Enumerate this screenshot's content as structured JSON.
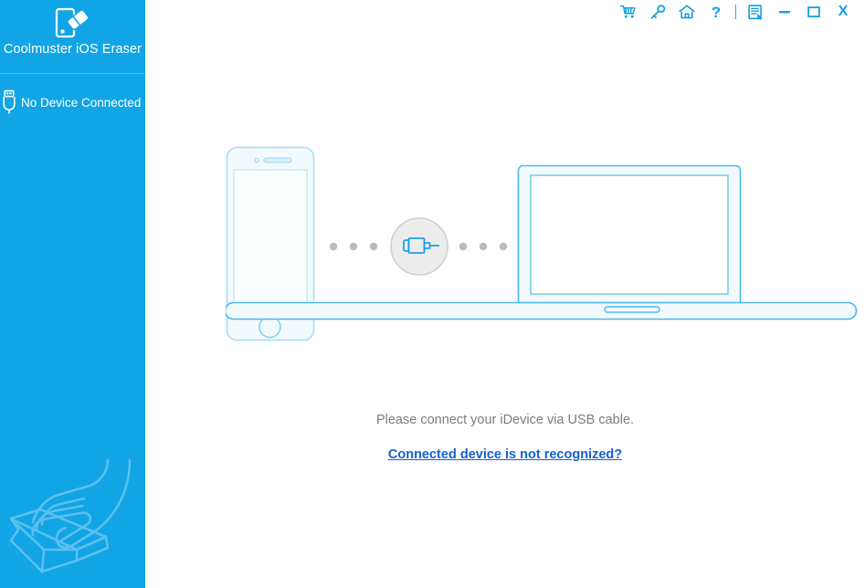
{
  "window": {
    "title": "Coolmuster iOS Eraser"
  },
  "sidebar": {
    "brand_title": "Coolmuster iOS Eraser",
    "logo_icon": "phone-eraser-icon",
    "device_status": {
      "icon": "usb-icon",
      "label": "No Device Connected"
    },
    "watermark_icon": "hand-holding-box-icon"
  },
  "titlebar": {
    "buttons": [
      {
        "name": "cart-icon",
        "label": ""
      },
      {
        "name": "key-icon",
        "label": ""
      },
      {
        "name": "home-icon",
        "label": ""
      },
      {
        "name": "help-icon",
        "label": "?"
      },
      {
        "name": "feedback-icon",
        "label": ""
      }
    ],
    "minimize_label": "",
    "maximize_label": "",
    "close_label": "X"
  },
  "main": {
    "illustration": {
      "phone_icon": "iphone-outline-icon",
      "connector_icon": "usb-plug-icon",
      "laptop_icon": "laptop-outline-icon",
      "left_dots": 3,
      "right_dots": 3
    },
    "caption": "Please connect your iDevice via USB cable.",
    "link": "Connected device is not recognized?"
  },
  "colors": {
    "sidebar_blue": "#12a5e5",
    "icon_blue": "#139fe0",
    "outline_blue": "#6fc9f0",
    "fill_blue": "#eef8fd",
    "link_blue": "#1461d2",
    "caption_gray": "#7d7d7d",
    "dot_gray": "#b6bcc2",
    "circle_gray": "#ededed"
  }
}
